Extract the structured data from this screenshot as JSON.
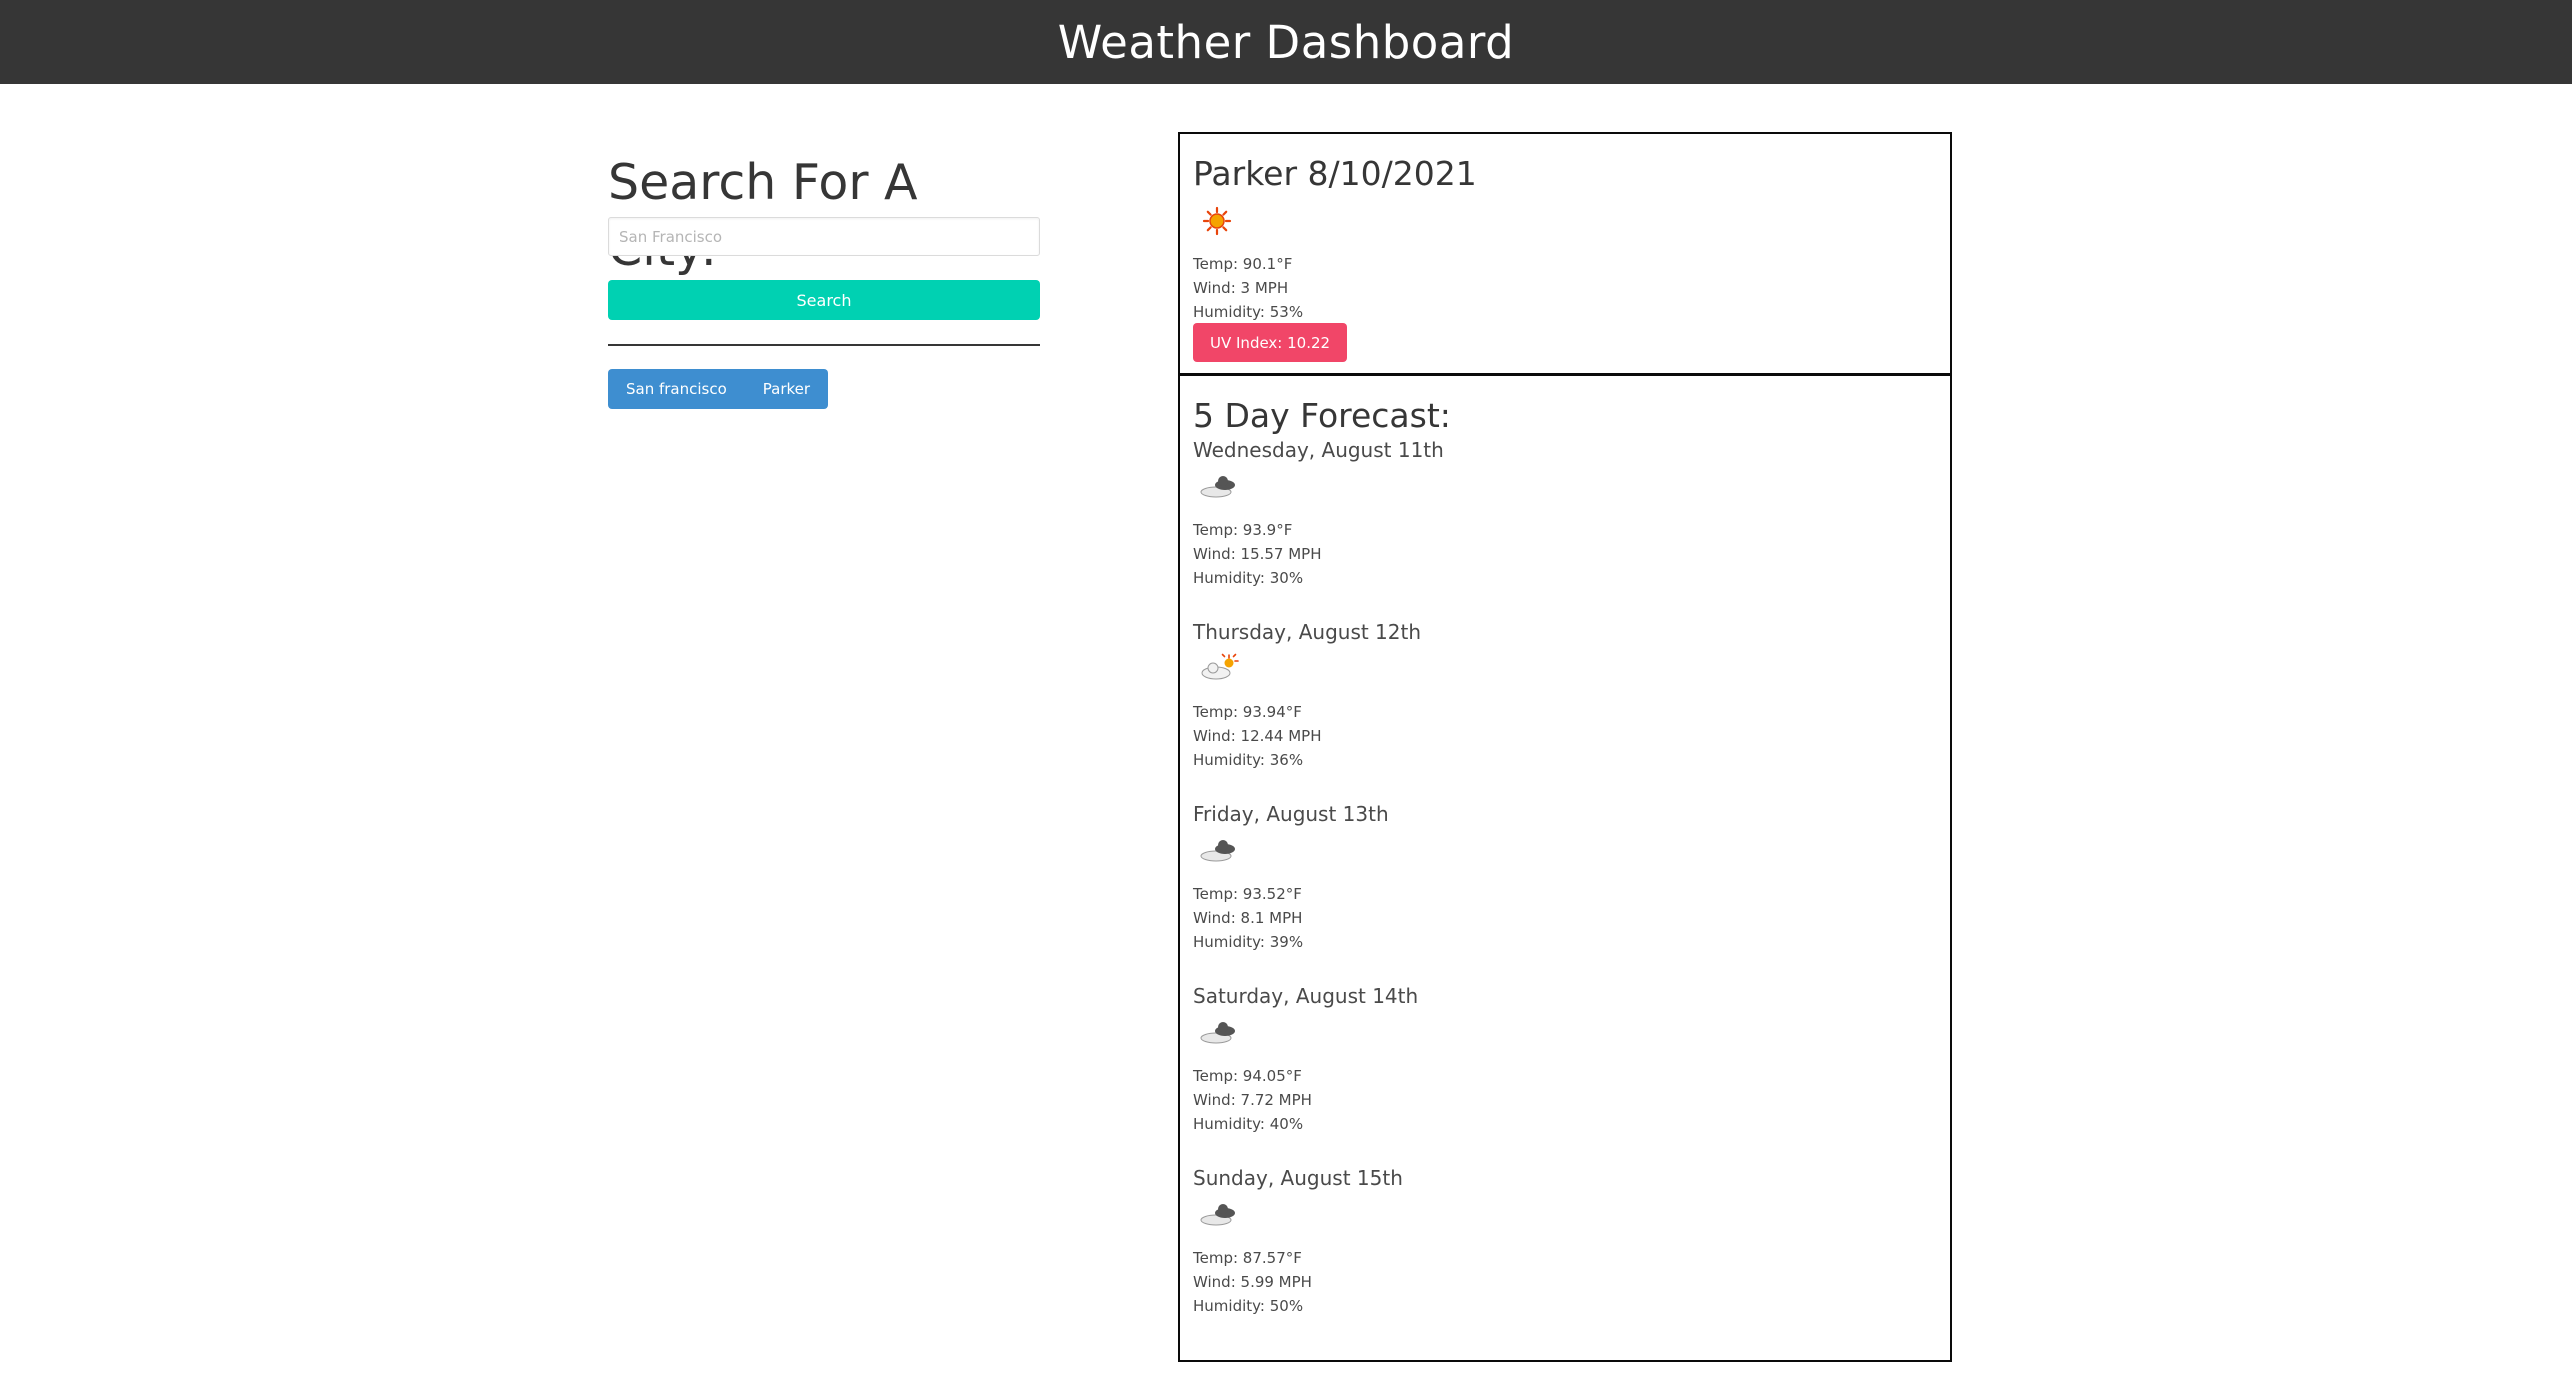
{
  "header": {
    "title": "Weather Dashboard"
  },
  "search": {
    "title": "Search For A City:",
    "placeholder": "San Francisco",
    "button_label": "Search"
  },
  "history": [
    "San francisco",
    "Parker"
  ],
  "current": {
    "title": "Parker 8/10/2021",
    "icon": "sun-icon",
    "temp": "Temp: 90.1°F",
    "wind": "Wind: 3 MPH",
    "humidity": "Humidity: 53%",
    "uv": "UV Index: 10.22",
    "uv_color": "#f14668"
  },
  "forecast": {
    "title": "5 Day Forecast:",
    "days": [
      {
        "name": "Wednesday, August 11th",
        "icon": "cloudy-icon",
        "temp": "Temp: 93.9°F",
        "wind": "Wind: 15.57 MPH",
        "humidity": "Humidity: 30%"
      },
      {
        "name": "Thursday, August 12th",
        "icon": "partly-cloudy-icon",
        "temp": "Temp: 93.94°F",
        "wind": "Wind: 12.44 MPH",
        "humidity": "Humidity: 36%"
      },
      {
        "name": "Friday, August 13th",
        "icon": "cloudy-icon",
        "temp": "Temp: 93.52°F",
        "wind": "Wind: 8.1 MPH",
        "humidity": "Humidity: 39%"
      },
      {
        "name": "Saturday, August 14th",
        "icon": "cloudy-icon",
        "temp": "Temp: 94.05°F",
        "wind": "Wind: 7.72 MPH",
        "humidity": "Humidity: 40%"
      },
      {
        "name": "Sunday, August 15th",
        "icon": "cloudy-icon",
        "temp": "Temp: 87.57°F",
        "wind": "Wind: 5.99 MPH",
        "humidity": "Humidity: 50%"
      }
    ]
  },
  "colors": {
    "header_bg": "#363636",
    "primary": "#00d1b2",
    "info": "#3e8ed0",
    "danger": "#f14668"
  }
}
